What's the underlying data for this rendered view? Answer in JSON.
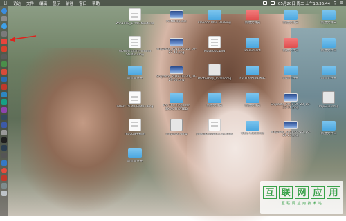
{
  "menubar": {
    "apple_icon": "apple-logo",
    "menus": [
      "访达",
      "文件",
      "编辑",
      "显示",
      "前往",
      "窗口",
      "帮助"
    ],
    "clock": "05月20日 周二 上午10:36:44"
  },
  "dock": {
    "items": [
      "finder",
      "launchpad",
      "safari",
      "settings",
      "chrome",
      "app",
      "app",
      "app",
      "app",
      "app",
      "app",
      "app",
      "app",
      "app",
      "app",
      "app",
      "app",
      "app",
      "app",
      "app",
      "app",
      "yandex",
      "app",
      "app",
      "trash"
    ]
  },
  "desktop": {
    "items": [
      {
        "label": "Win10PE_170816x64.iso",
        "kind": "file"
      },
      {
        "label": "PicNHelp.exe",
        "kind": "shot"
      },
      {
        "label": "Oooooo Mac Hacking",
        "kind": "folder"
      },
      {
        "label": "新建文件夹",
        "kind": "redfolder"
      },
      {
        "label": "新建文件夹",
        "kind": "folder"
      },
      {
        "label": "新建文件夹",
        "kind": "folder"
      },
      {
        "label": "WondershareFilmora Studio.dmg",
        "kind": "file"
      },
      {
        "label": "Snipaste_2018-05-20_10-27-43.png",
        "kind": "shot"
      },
      {
        "label": "MacBook.png",
        "kind": "file"
      },
      {
        "label": "Document",
        "kind": "folder"
      },
      {
        "label": "新建文件夹",
        "kind": "redfolder"
      },
      {
        "label": "新建文件夹",
        "kind": "folder"
      },
      {
        "label": "新建文件夹",
        "kind": "folder"
      },
      {
        "label": "Snipaste_2018-05-20_10-29-00.png",
        "kind": "shot"
      },
      {
        "label": "Photoshop_Intall.dmg",
        "kind": "disk"
      },
      {
        "label": "ForThe.King.Mac",
        "kind": "folder"
      },
      {
        "label": "新建文件夹",
        "kind": "folder"
      },
      {
        "label": "新建文件夹",
        "kind": "folder"
      },
      {
        "label": "Polarr Photo Editor.dmg",
        "kind": "file"
      },
      {
        "label": "For.The.King.Mac SX.ACTIVATED",
        "kind": "folder"
      },
      {
        "label": "新建文件夹",
        "kind": "folder"
      },
      {
        "label": "新建文件夹",
        "kind": "folder"
      },
      {
        "label": "Snipaste_2018-05-20_10-23-36.png",
        "kind": "shot"
      },
      {
        "label": "PopClip.dmg",
        "kind": "disk"
      },
      {
        "label": "macOS中截图",
        "kind": "file"
      },
      {
        "label": "Snipaste.dmg",
        "kind": "disk"
      },
      {
        "label": "pinxiao-down-2.52.mac",
        "kind": "file"
      },
      {
        "label": "Ultra Machines",
        "kind": "folder"
      },
      {
        "label": "Snipaste_2018-05-20_10-26-23.png",
        "kind": "shot"
      },
      {
        "label": "新建文件夹",
        "kind": "folder"
      },
      {
        "label": "新建文件夹",
        "kind": "folder"
      }
    ]
  },
  "watermark": {
    "chars": [
      "互",
      "联",
      "网",
      "应",
      "用"
    ],
    "subtitle": "互 联 网 应 用 技 术 站"
  },
  "colors": {
    "accent": "#3aa24a",
    "folder": "#4aa7e0"
  }
}
